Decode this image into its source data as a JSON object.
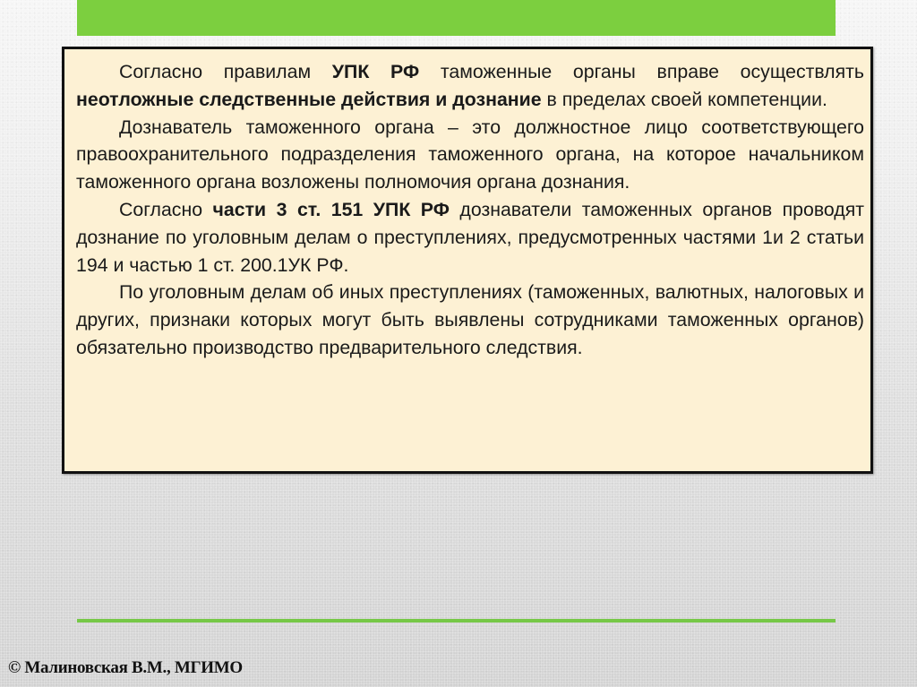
{
  "slide": {
    "accent_color": "#7ccf3f",
    "box_background": "#fdf1d4",
    "paragraphs": [
      {
        "segments": [
          {
            "text": "Согласно правилам ",
            "bold": false
          },
          {
            "text": "УПК РФ",
            "bold": true
          },
          {
            "text": " таможенные органы вправе осуществлять ",
            "bold": false
          },
          {
            "text": "неотложные следственные действия и дознание",
            "bold": true
          },
          {
            "text": " в пределах своей компетенции.",
            "bold": false
          }
        ]
      },
      {
        "segments": [
          {
            "text": "Дознаватель таможенного органа – это должностное лицо соответствующего правоохранительного подразделения таможенного органа, на которое начальником таможенного органа возложены полномочия органа дознания.",
            "bold": false
          }
        ]
      },
      {
        "segments": [
          {
            "text": "Согласно ",
            "bold": false
          },
          {
            "text": "части 3 ст. 151 УПК РФ",
            "bold": true
          },
          {
            "text": " дознаватели таможенных органов проводят дознание по уголовным делам о преступлениях, предусмотренных частями 1и 2 статьи  194 и частью 1 ст. 200.1УК РФ.",
            "bold": false
          }
        ]
      },
      {
        "segments": [
          {
            "text": "По уголовным делам об иных преступлениях (таможенных, валютных, налоговых и других, признаки которых могут быть выявлены сотрудниками таможенных органов) обязательно производство предварительного следствия.",
            "bold": false
          }
        ]
      }
    ],
    "footer": {
      "copyright": "© Малиновская В.М., МГИМО"
    }
  }
}
